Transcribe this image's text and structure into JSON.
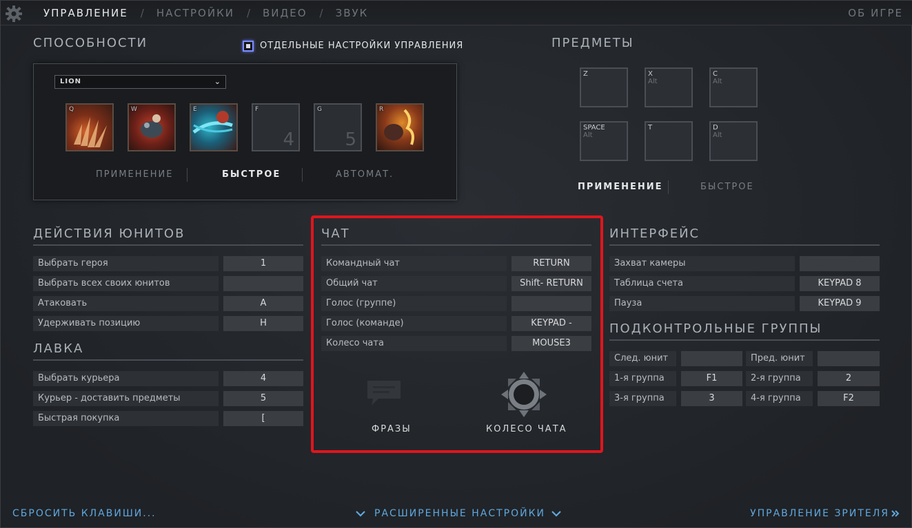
{
  "nav": {
    "tabs": [
      "УПРАВЛЕНИЕ",
      "НАСТРОЙКИ",
      "ВИДЕО",
      "ЗВУК"
    ],
    "separator": "/",
    "about": "ОБ ИГРЕ"
  },
  "abilities": {
    "title": "СПОСОБНОСТИ",
    "separate_settings_label": "ОТДЕЛЬНЫЕ НАСТРОЙКИ УПРАВЛЕНИЯ",
    "hero": "LION",
    "slots": [
      {
        "key": "Q",
        "num": ""
      },
      {
        "key": "W",
        "num": ""
      },
      {
        "key": "E",
        "num": ""
      },
      {
        "key": "F",
        "num": "4"
      },
      {
        "key": "G",
        "num": "5"
      },
      {
        "key": "R",
        "num": ""
      }
    ],
    "modes": [
      "ПРИМЕНЕНИЕ",
      "БЫСТРОЕ",
      "АВТОМАТ."
    ],
    "active_mode": "БЫСТРОЕ"
  },
  "items": {
    "title": "ПРЕДМЕТЫ",
    "slots": [
      {
        "key": "Z",
        "mod": ""
      },
      {
        "key": "X",
        "mod": "Alt"
      },
      {
        "key": "C",
        "mod": "Alt"
      },
      {
        "key": "SPACE",
        "mod": "Alt"
      },
      {
        "key": "T",
        "mod": ""
      },
      {
        "key": "D",
        "mod": "Alt"
      }
    ],
    "modes": [
      "ПРИМЕНЕНИЕ",
      "БЫСТРОЕ"
    ],
    "active_mode": "ПРИМЕНЕНИЕ"
  },
  "unit_actions": {
    "title": "ДЕЙСТВИЯ ЮНИТОВ",
    "rows": [
      {
        "label": "Выбрать героя",
        "key": "1"
      },
      {
        "label": "Выбрать всех своих юнитов",
        "key": ""
      },
      {
        "label": "Атаковать",
        "key": "A"
      },
      {
        "label": "Удерживать позицию",
        "key": "H"
      }
    ]
  },
  "shop": {
    "title": "ЛАВКА",
    "rows": [
      {
        "label": "Выбрать курьера",
        "key": "4"
      },
      {
        "label": "Курьер - доставить предметы",
        "key": "5"
      },
      {
        "label": "Быстрая покупка",
        "key": "["
      }
    ]
  },
  "chat": {
    "title": "ЧАТ",
    "rows": [
      {
        "label": "Командный чат",
        "key": "RETURN"
      },
      {
        "label": "Общий чат",
        "key": "Shift- RETURN"
      },
      {
        "label": "Голос (группе)",
        "key": ""
      },
      {
        "label": "Голос (команде)",
        "key": "KEYPAD -"
      },
      {
        "label": "Колесо чата",
        "key": "MOUSE3"
      }
    ],
    "phrases_label": "ФРАЗЫ",
    "wheel_label": "КОЛЕСО ЧАТА",
    "highlight_color": "#e0151d"
  },
  "interface": {
    "title": "ИНТЕРФЕЙС",
    "rows": [
      {
        "label": "Захват камеры",
        "key": ""
      },
      {
        "label": "Таблица счета",
        "key": "KEYPAD 8"
      },
      {
        "label": "Пауза",
        "key": "KEYPAD 9"
      }
    ]
  },
  "control_groups": {
    "title": "ПОДКОНТРОЛЬНЫЕ ГРУППЫ",
    "rows": [
      [
        {
          "label": "След. юнит",
          "key": ""
        },
        {
          "label": "Пред. юнит",
          "key": ""
        }
      ],
      [
        {
          "label": "1-я группа",
          "key": "F1"
        },
        {
          "label": "2-я группа",
          "key": "2"
        }
      ],
      [
        {
          "label": "3-я группа",
          "key": "3"
        },
        {
          "label": "4-я группа",
          "key": "F2"
        }
      ]
    ]
  },
  "footer": {
    "reset": "СБРОСИТЬ КЛАВИШИ...",
    "advanced": "РАСШИРЕННЫЕ НАСТРОЙКИ",
    "spectator": "УПРАВЛЕНИЕ ЗРИТЕЛЯ",
    "link_color": "#5fa8e0"
  }
}
